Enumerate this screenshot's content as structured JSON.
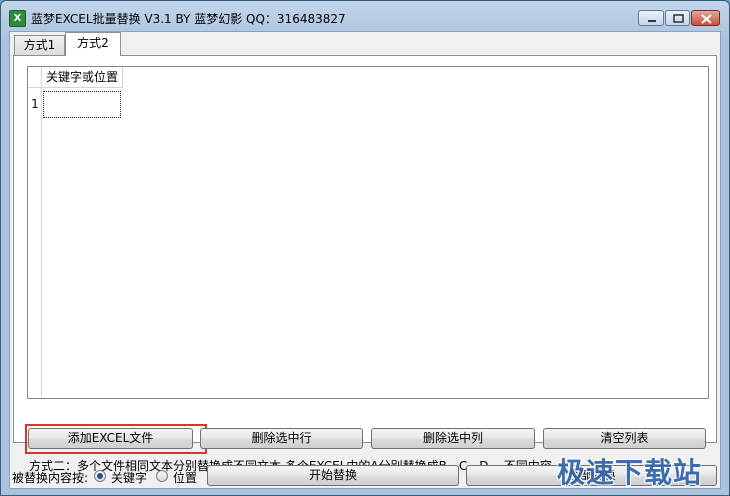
{
  "window": {
    "title": "蓝梦EXCEL批量替换 V3.1 BY 蓝梦幻影 QQ：316483827",
    "icon": "excel-app-icon"
  },
  "tabs": [
    {
      "label": "方式1",
      "active": false
    },
    {
      "label": "方式2",
      "active": true
    }
  ],
  "grid": {
    "column_header": "关键字或位置",
    "rows": [
      {
        "num": "1",
        "value": ""
      }
    ]
  },
  "buttons": {
    "add_excel": "添加EXCEL文件",
    "delete_row": "删除选中行",
    "delete_col": "删除选中列",
    "clear_list": "清空列表"
  },
  "description": "方式二：多个文件相同文本分别替换成不同文本  多个EXCEL中的A分别替换成B、C、D...  不同内容",
  "bottom": {
    "label": "被替换内容按:",
    "options": [
      {
        "label": "关键字",
        "checked": true
      },
      {
        "label": "位置",
        "checked": false
      }
    ],
    "start_button": "开始替换",
    "all_replace_button": "全部替换"
  },
  "watermark": "极速下载站",
  "colors": {
    "highlight": "#d7362f",
    "title_bar": "#a9c2dd",
    "watermark": "#2f63a6"
  }
}
